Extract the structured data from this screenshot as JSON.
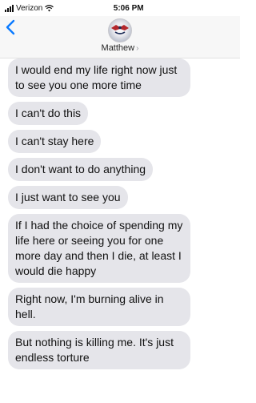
{
  "status": {
    "carrier": "Verizon",
    "time": "5:06 PM"
  },
  "header": {
    "contact_name": "Matthew",
    "chevron": "›",
    "avatar_icon": "avatar-icon"
  },
  "messages": [
    "I would end my life right now just to see you one more time",
    "I can't do this",
    "I can't stay here",
    "I don't want to do anything",
    "I just want to see you",
    "If I had the choice of spending my life here or seeing you for one more day and then I die, at least I would die happy",
    "Right now, I'm burning alive in hell.",
    "But nothing is killing me. It's just endless torture"
  ],
  "colors": {
    "accent": "#0a7aff",
    "bubble": "#e5e5ea"
  }
}
